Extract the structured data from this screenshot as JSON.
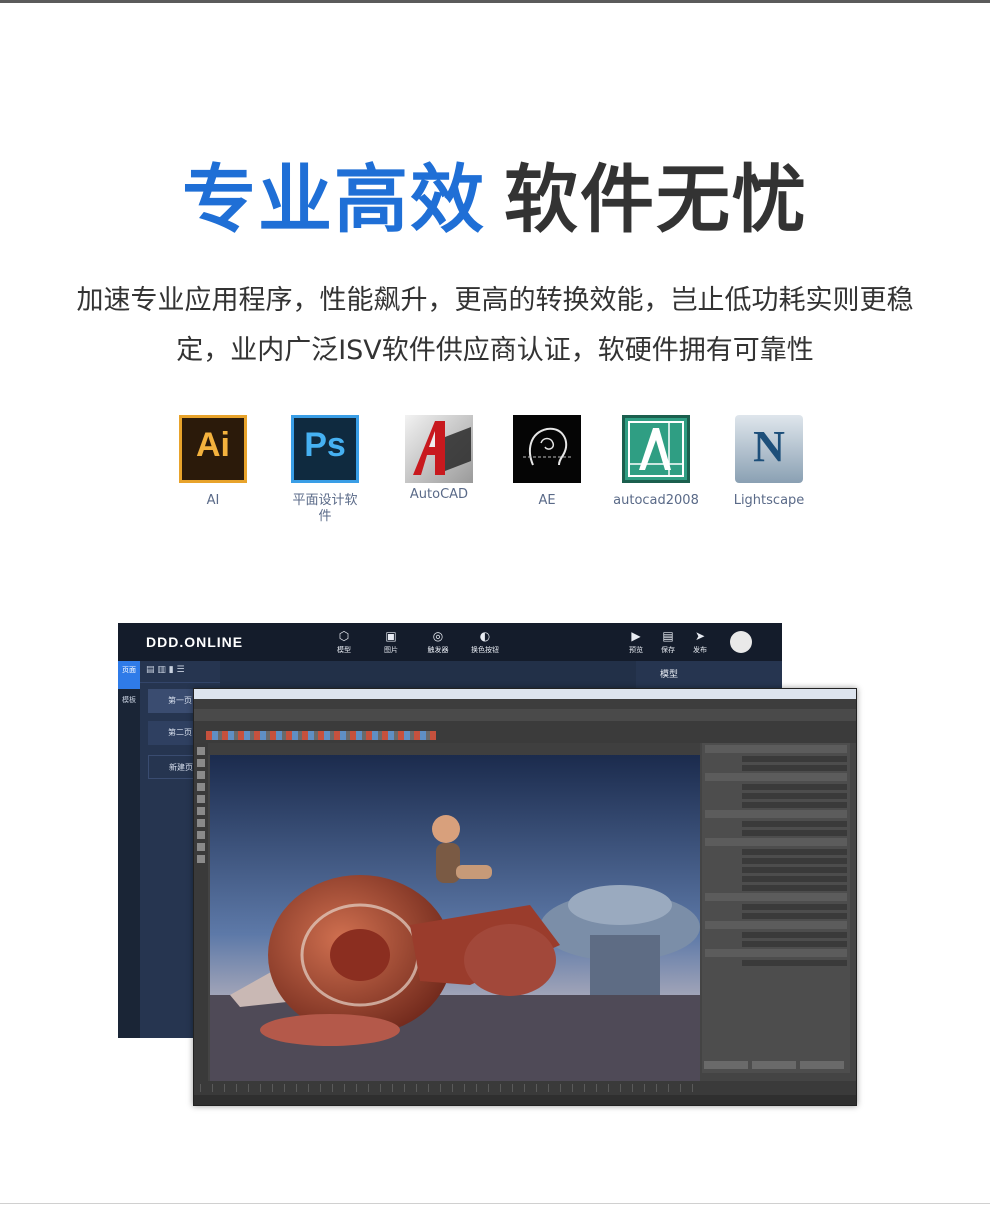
{
  "headline": {
    "blue": "专业高效",
    "dark": "软件无忧"
  },
  "description": {
    "line1": "加速专业应用程序，性能飙升，更高的转换效能，岂止低功耗实则更稳",
    "line2": "定，业内广泛ISV软件供应商认证，软硬件拥有可靠性"
  },
  "apps": [
    {
      "icon": "ai-icon",
      "tile_text": "Ai",
      "label": "AI"
    },
    {
      "icon": "photoshop-icon",
      "tile_text": "Ps",
      "label": "平面设计软件"
    },
    {
      "icon": "autocad-icon",
      "label": "AutoCAD"
    },
    {
      "icon": "after-effects-icon",
      "label": "AE"
    },
    {
      "icon": "autocad2008-icon",
      "label": "autocad2008"
    },
    {
      "icon": "lightscape-icon",
      "tile_text": "N",
      "label": "Lightscape"
    }
  ],
  "ddd_app": {
    "logo": "DDD.ONLINE",
    "toolbar": [
      "模型",
      "图片",
      "触发器",
      "换色按钮"
    ],
    "actions": [
      "预览",
      "保存",
      "发布"
    ],
    "left_tabs": [
      "页面",
      "模板"
    ],
    "pages": [
      "第一页",
      "第二页",
      "新建页"
    ],
    "panel_title": "模型"
  },
  "colors": {
    "accent_blue": "#1f6fd6",
    "headline_dark": "#333333",
    "app_label": "#5a6a88",
    "ddd_bg": "#223048",
    "maya_bg": "#444444"
  }
}
